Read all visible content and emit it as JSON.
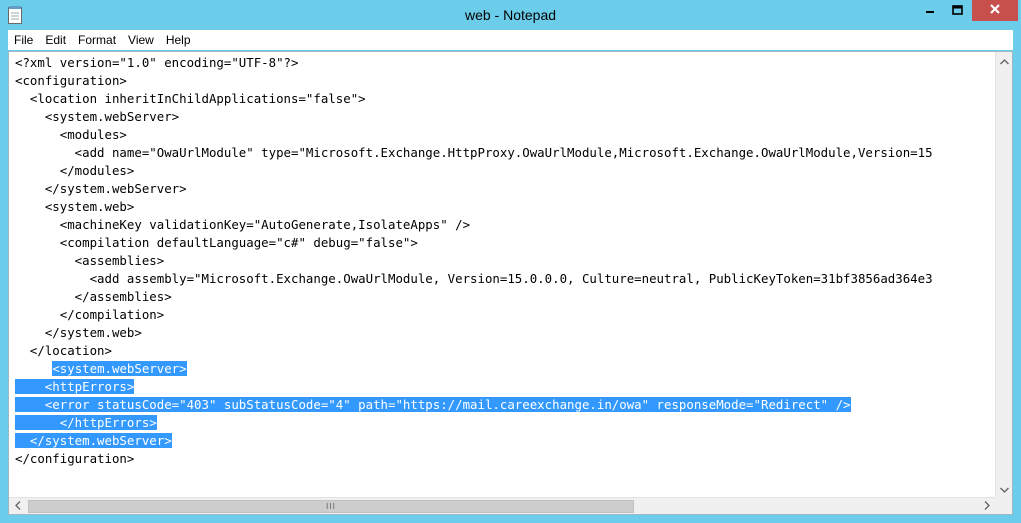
{
  "window": {
    "title": "web - Notepad"
  },
  "menu": [
    "File",
    "Edit",
    "Format",
    "View",
    "Help"
  ],
  "lines": [
    {
      "text": "<?xml version=\"1.0\" encoding=\"UTF-8\"?>",
      "sel": false
    },
    {
      "text": "<configuration>",
      "sel": false
    },
    {
      "text": "  <location inheritInChildApplications=\"false\">",
      "sel": false
    },
    {
      "text": "    <system.webServer>",
      "sel": false
    },
    {
      "text": "      <modules>",
      "sel": false
    },
    {
      "text": "        <add name=\"OwaUrlModule\" type=\"Microsoft.Exchange.HttpProxy.OwaUrlModule,Microsoft.Exchange.OwaUrlModule,Version=15",
      "sel": false
    },
    {
      "text": "      </modules>",
      "sel": false
    },
    {
      "text": "    </system.webServer>",
      "sel": false
    },
    {
      "text": "    <system.web>",
      "sel": false
    },
    {
      "text": "      <machineKey validationKey=\"AutoGenerate,IsolateApps\" />",
      "sel": false
    },
    {
      "text": "      <compilation defaultLanguage=\"c#\" debug=\"false\">",
      "sel": false
    },
    {
      "text": "        <assemblies>",
      "sel": false
    },
    {
      "text": "          <add assembly=\"Microsoft.Exchange.OwaUrlModule, Version=15.0.0.0, Culture=neutral, PublicKeyToken=31bf3856ad364e3",
      "sel": false
    },
    {
      "text": "        </assemblies>",
      "sel": false
    },
    {
      "text": "      </compilation>",
      "sel": false
    },
    {
      "text": "    </system.web>",
      "sel": false
    },
    {
      "text": "  </location>",
      "sel": false
    },
    {
      "text": "     <system.webServer>",
      "sel": true,
      "sel_start": 5
    },
    {
      "text": "    <httpErrors>",
      "sel": true,
      "sel_start": 0
    },
    {
      "text": "    <error statusCode=\"403\" subStatusCode=\"4\" path=\"https://mail.careexchange.in/owa\" responseMode=\"Redirect\" />",
      "sel": true,
      "sel_start": 0
    },
    {
      "text": "      </httpErrors>",
      "sel": true,
      "sel_start": 0
    },
    {
      "text": "  </system.webServer>",
      "sel": true,
      "sel_start": 0
    },
    {
      "text": "</configuration>",
      "sel": false
    }
  ],
  "scroll": {
    "thumb_glyph": "III"
  },
  "colors": {
    "chrome": "#6ccdea",
    "selection": "#3399ff",
    "close": "#c7504c"
  },
  "icons": {
    "app": "notepad-icon",
    "minimize": "minimize-icon",
    "maximize": "maximize-icon",
    "close": "close-icon"
  }
}
